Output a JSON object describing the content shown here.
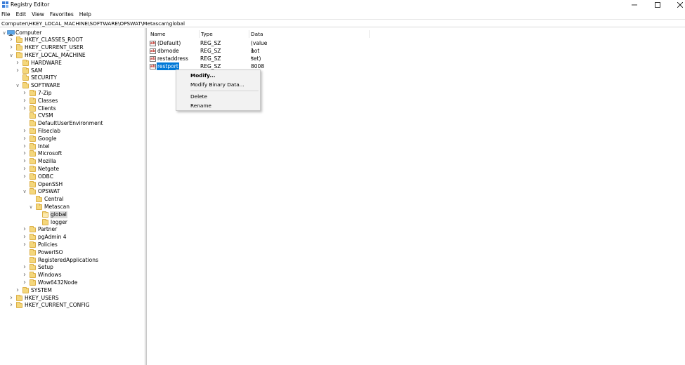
{
  "window": {
    "title": "Registry Editor"
  },
  "menubar": [
    "File",
    "Edit",
    "View",
    "Favorites",
    "Help"
  ],
  "address": "Computer\\HKEY_LOCAL_MACHINE\\SOFTWARE\\OPSWAT\\Metascan\\global",
  "tree": [
    {
      "label": "Computer",
      "icon": "computer-icon",
      "expander": "expanded"
    },
    {
      "label": "HKEY_CLASSES_ROOT",
      "expander": "collapsed"
    },
    {
      "label": "HKEY_CURRENT_USER",
      "expander": "collapsed"
    },
    {
      "label": "HKEY_LOCAL_MACHINE",
      "expander": "expanded"
    },
    {
      "label": "HARDWARE",
      "expander": "collapsed"
    },
    {
      "label": "SAM",
      "expander": "collapsed"
    },
    {
      "label": "SECURITY",
      "expander": "none"
    },
    {
      "label": "SOFTWARE",
      "expander": "expanded"
    },
    {
      "label": "7-Zip",
      "expander": "collapsed"
    },
    {
      "label": "Classes",
      "expander": "collapsed"
    },
    {
      "label": "Clients",
      "expander": "collapsed"
    },
    {
      "label": "CVSM",
      "expander": "none"
    },
    {
      "label": "DefaultUserEnvironment",
      "expander": "none"
    },
    {
      "label": "Filseclab",
      "expander": "collapsed"
    },
    {
      "label": "Google",
      "expander": "collapsed"
    },
    {
      "label": "Intel",
      "expander": "collapsed"
    },
    {
      "label": "Microsoft",
      "expander": "collapsed"
    },
    {
      "label": "Mozilla",
      "expander": "collapsed"
    },
    {
      "label": "Netgate",
      "expander": "collapsed"
    },
    {
      "label": "ODBC",
      "expander": "collapsed"
    },
    {
      "label": "OpenSSH",
      "expander": "none"
    },
    {
      "label": "OPSWAT",
      "expander": "expanded"
    },
    {
      "label": "Central",
      "expander": "none"
    },
    {
      "label": "Metascan",
      "expander": "expanded"
    },
    {
      "label": "global",
      "expander": "none",
      "selected": true
    },
    {
      "label": "logger",
      "expander": "none"
    },
    {
      "label": "Partner",
      "expander": "collapsed"
    },
    {
      "label": "pgAdmin 4",
      "expander": "collapsed"
    },
    {
      "label": "Policies",
      "expander": "collapsed"
    },
    {
      "label": "PowerISO",
      "expander": "none"
    },
    {
      "label": "RegisteredApplications",
      "expander": "none"
    },
    {
      "label": "Setup",
      "expander": "collapsed"
    },
    {
      "label": "Windows",
      "expander": "collapsed"
    },
    {
      "label": "Wow6432Node",
      "expander": "collapsed"
    },
    {
      "label": "SYSTEM",
      "expander": "collapsed"
    },
    {
      "label": "HKEY_USERS",
      "expander": "collapsed"
    },
    {
      "label": "HKEY_CURRENT_CONFIG",
      "expander": "collapsed"
    }
  ],
  "columns": {
    "name": "Name",
    "type": "Type",
    "data": "Data"
  },
  "values": [
    {
      "name": "(Default)",
      "type": "REG_SZ",
      "data": "(value not set)"
    },
    {
      "name": "dbmode",
      "type": "REG_SZ",
      "data": "1"
    },
    {
      "name": "restaddress",
      "type": "REG_SZ",
      "data": "*"
    },
    {
      "name": "restport",
      "type": "REG_SZ",
      "data": "8008",
      "selected": true
    }
  ],
  "context_menu": {
    "modify": "Modify...",
    "modify_binary": "Modify Binary Data...",
    "delete": "Delete",
    "rename": "Rename"
  },
  "colors": {
    "selection": "#0078d7",
    "folder": "#f4d77c",
    "tree_selection": "#d9d9d9"
  }
}
